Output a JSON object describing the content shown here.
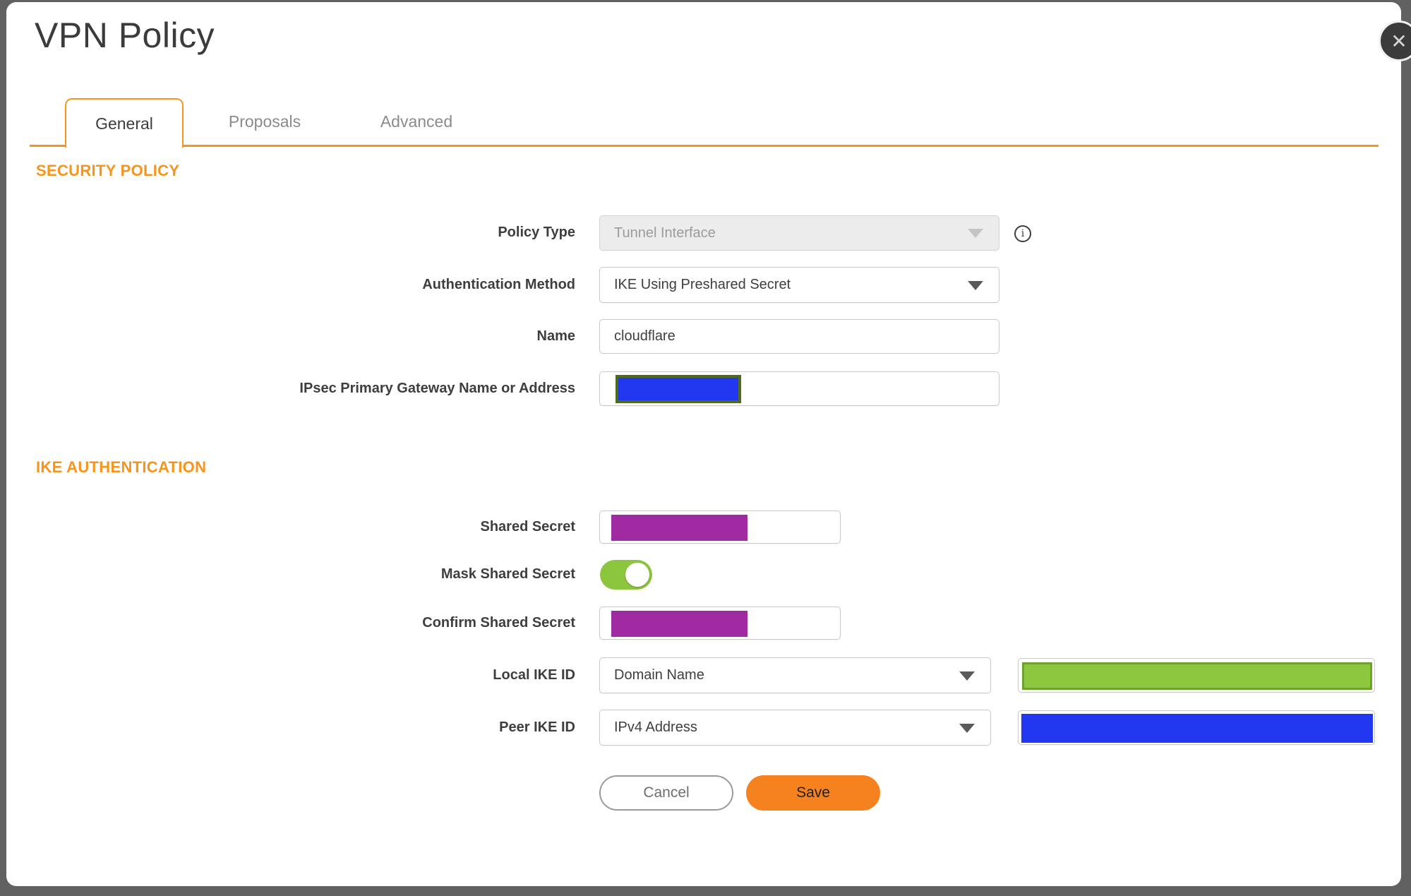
{
  "dialog": {
    "title": "VPN Policy"
  },
  "icons": {
    "close": "✕",
    "info": "i"
  },
  "tabs": [
    {
      "label": "General",
      "active": true
    },
    {
      "label": "Proposals",
      "active": false
    },
    {
      "label": "Advanced",
      "active": false
    }
  ],
  "security_policy": {
    "heading": "SECURITY POLICY",
    "policy_type": {
      "label": "Policy Type",
      "value": "Tunnel Interface",
      "disabled": true
    },
    "authentication_method": {
      "label": "Authentication Method",
      "value": "IKE Using Preshared Secret"
    },
    "name": {
      "label": "Name",
      "value": "cloudflare"
    },
    "gateway": {
      "label": "IPsec Primary Gateway Name or Address",
      "value_redacted": true
    }
  },
  "ike_authentication": {
    "heading": "IKE AUTHENTICATION",
    "shared_secret": {
      "label": "Shared Secret",
      "value_redacted": true
    },
    "mask_shared_secret": {
      "label": "Mask Shared Secret",
      "enabled": true
    },
    "confirm_shared_secret": {
      "label": "Confirm Shared Secret",
      "value_redacted": true
    },
    "local_ike_id": {
      "label": "Local IKE ID",
      "value": "Domain Name",
      "id_value_redacted": true
    },
    "peer_ike_id": {
      "label": "Peer IKE ID",
      "value": "IPv4 Address",
      "id_value_redacted": true
    }
  },
  "actions": {
    "cancel": "Cancel",
    "save": "Save"
  },
  "colors": {
    "accent_orange": "#f7941d",
    "save_button_orange": "#f6821f",
    "toggle_green": "#8cc63f",
    "redaction_purple": "#a02aa2",
    "redaction_blue": "#2138f0",
    "redaction_green": "#8dc63f",
    "redaction_green_border": "#6da32d",
    "redaction_olive_border": "#4e6b1d",
    "page_background": "#616161"
  }
}
